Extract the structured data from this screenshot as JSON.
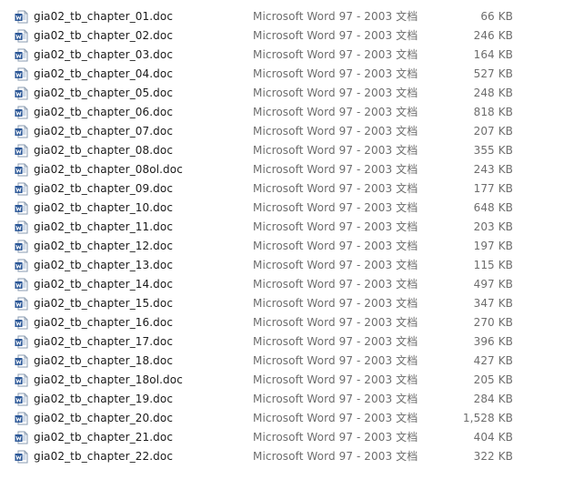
{
  "file_icon": "word-document-icon",
  "files": [
    {
      "name": "gia02_tb_chapter_01.doc",
      "type": "Microsoft Word 97 - 2003 文档",
      "size": "66 KB"
    },
    {
      "name": "gia02_tb_chapter_02.doc",
      "type": "Microsoft Word 97 - 2003 文档",
      "size": "246 KB"
    },
    {
      "name": "gia02_tb_chapter_03.doc",
      "type": "Microsoft Word 97 - 2003 文档",
      "size": "164 KB"
    },
    {
      "name": "gia02_tb_chapter_04.doc",
      "type": "Microsoft Word 97 - 2003 文档",
      "size": "527 KB"
    },
    {
      "name": "gia02_tb_chapter_05.doc",
      "type": "Microsoft Word 97 - 2003 文档",
      "size": "248 KB"
    },
    {
      "name": "gia02_tb_chapter_06.doc",
      "type": "Microsoft Word 97 - 2003 文档",
      "size": "818 KB"
    },
    {
      "name": "gia02_tb_chapter_07.doc",
      "type": "Microsoft Word 97 - 2003 文档",
      "size": "207 KB"
    },
    {
      "name": "gia02_tb_chapter_08.doc",
      "type": "Microsoft Word 97 - 2003 文档",
      "size": "355 KB"
    },
    {
      "name": "gia02_tb_chapter_08ol.doc",
      "type": "Microsoft Word 97 - 2003 文档",
      "size": "243 KB"
    },
    {
      "name": "gia02_tb_chapter_09.doc",
      "type": "Microsoft Word 97 - 2003 文档",
      "size": "177 KB"
    },
    {
      "name": "gia02_tb_chapter_10.doc",
      "type": "Microsoft Word 97 - 2003 文档",
      "size": "648 KB"
    },
    {
      "name": "gia02_tb_chapter_11.doc",
      "type": "Microsoft Word 97 - 2003 文档",
      "size": "203 KB"
    },
    {
      "name": "gia02_tb_chapter_12.doc",
      "type": "Microsoft Word 97 - 2003 文档",
      "size": "197 KB"
    },
    {
      "name": "gia02_tb_chapter_13.doc",
      "type": "Microsoft Word 97 - 2003 文档",
      "size": "115 KB"
    },
    {
      "name": "gia02_tb_chapter_14.doc",
      "type": "Microsoft Word 97 - 2003 文档",
      "size": "497 KB"
    },
    {
      "name": "gia02_tb_chapter_15.doc",
      "type": "Microsoft Word 97 - 2003 文档",
      "size": "347 KB"
    },
    {
      "name": "gia02_tb_chapter_16.doc",
      "type": "Microsoft Word 97 - 2003 文档",
      "size": "270 KB"
    },
    {
      "name": "gia02_tb_chapter_17.doc",
      "type": "Microsoft Word 97 - 2003 文档",
      "size": "396 KB"
    },
    {
      "name": "gia02_tb_chapter_18.doc",
      "type": "Microsoft Word 97 - 2003 文档",
      "size": "427 KB"
    },
    {
      "name": "gia02_tb_chapter_18ol.doc",
      "type": "Microsoft Word 97 - 2003 文档",
      "size": "205 KB"
    },
    {
      "name": "gia02_tb_chapter_19.doc",
      "type": "Microsoft Word 97 - 2003 文档",
      "size": "284 KB"
    },
    {
      "name": "gia02_tb_chapter_20.doc",
      "type": "Microsoft Word 97 - 2003 文档",
      "size": "1,528 KB"
    },
    {
      "name": "gia02_tb_chapter_21.doc",
      "type": "Microsoft Word 97 - 2003 文档",
      "size": "404 KB"
    },
    {
      "name": "gia02_tb_chapter_22.doc",
      "type": "Microsoft Word 97 - 2003 文档",
      "size": "322 KB"
    }
  ]
}
